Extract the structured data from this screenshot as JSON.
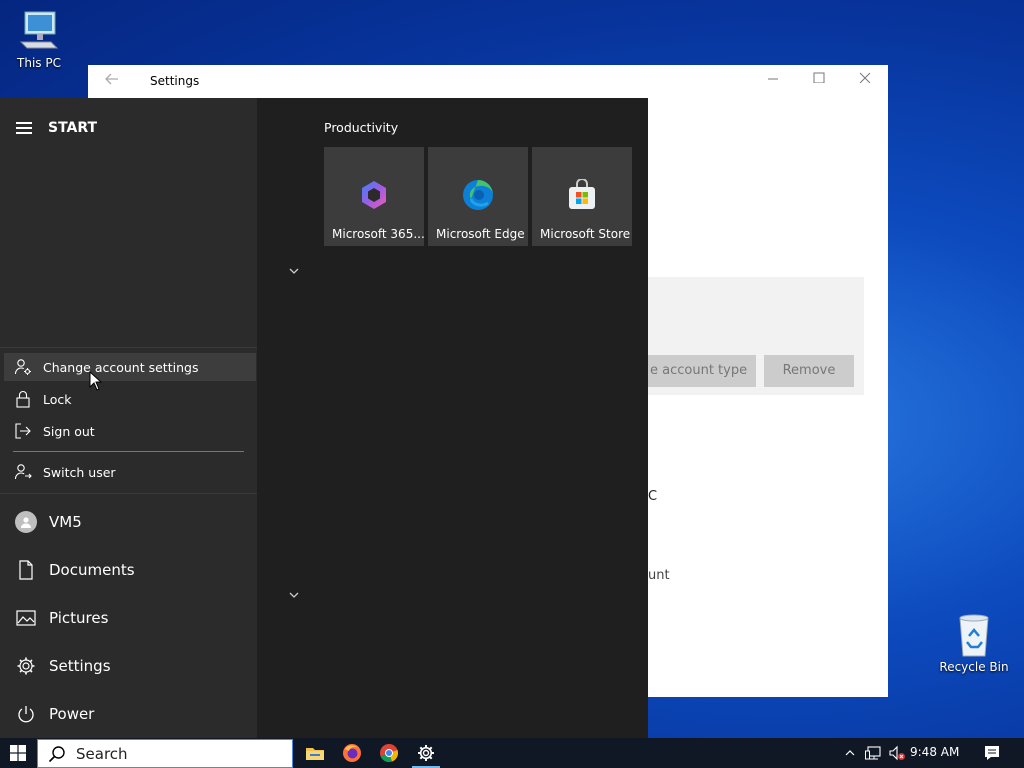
{
  "desktop": {
    "icons": [
      {
        "label": "This PC",
        "icon": "computer-icon"
      },
      {
        "label": "Recycle Bin",
        "icon": "recycle-bin-icon"
      }
    ]
  },
  "settings_window": {
    "title": "Settings",
    "buttons": {
      "change_type": "e account type",
      "remove": "Remove"
    },
    "partial_text": [
      "C",
      "unt"
    ]
  },
  "start_menu": {
    "title": "START",
    "account_flyout": [
      {
        "label": "Change account settings",
        "icon": "person-gear-icon",
        "hovered": true
      },
      {
        "label": "Lock",
        "icon": "lock-icon"
      },
      {
        "label": "Sign out",
        "icon": "sign-out-icon"
      },
      {
        "label": "Switch user",
        "icon": "switch-user-icon"
      }
    ],
    "nav": [
      {
        "label": "VM5",
        "icon": "user-avatar-icon"
      },
      {
        "label": "Documents",
        "icon": "document-icon"
      },
      {
        "label": "Pictures",
        "icon": "pictures-icon"
      },
      {
        "label": "Settings",
        "icon": "gear-icon"
      },
      {
        "label": "Power",
        "icon": "power-icon"
      }
    ],
    "group": {
      "title": "Productivity",
      "tiles": [
        {
          "label": "Microsoft 365...",
          "icon": "microsoft-365-icon"
        },
        {
          "label": "Microsoft Edge",
          "icon": "edge-icon"
        },
        {
          "label": "Microsoft Store",
          "icon": "store-icon"
        }
      ]
    }
  },
  "taskbar": {
    "search_placeholder": "Search",
    "apps": [
      "file-explorer-icon",
      "firefox-icon",
      "chrome-icon",
      "settings-gear-icon"
    ],
    "clock": "9:48 AM"
  },
  "colors": {
    "accent": "#0078d7",
    "start_bg": "#2b2b2b",
    "tile_bg": "#3c3c3c"
  }
}
